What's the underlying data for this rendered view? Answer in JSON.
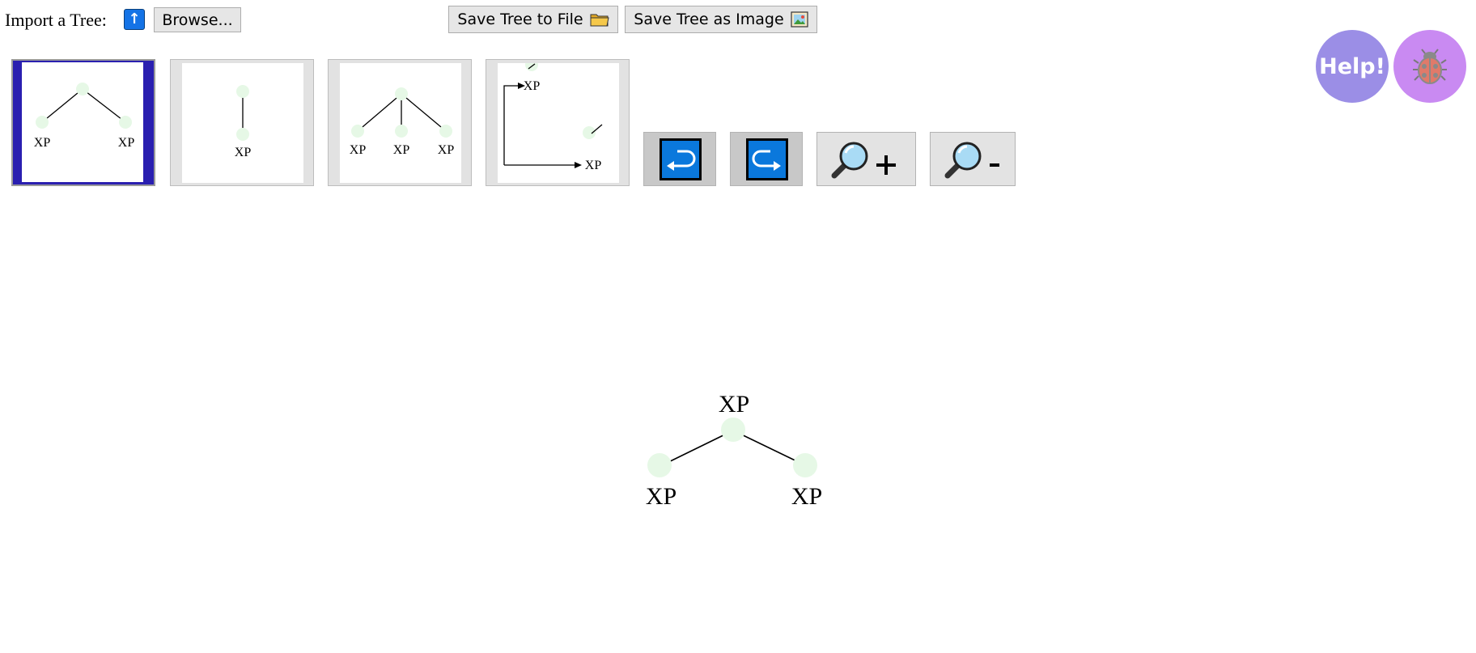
{
  "toolbar": {
    "import_label": "Import a Tree:",
    "upload_icon": "upload-arrow-icon",
    "browse_label": "Browse...",
    "save_file_label": "Save Tree to File",
    "save_image_label": "Save Tree as Image"
  },
  "templates": [
    {
      "id": "binary",
      "labels": [
        "XP",
        "XP"
      ],
      "selected": true
    },
    {
      "id": "unary",
      "labels": [
        "XP"
      ],
      "selected": false
    },
    {
      "id": "ternary",
      "labels": [
        "XP",
        "XP",
        "XP"
      ],
      "selected": false
    },
    {
      "id": "movement",
      "labels": [
        "XP",
        "XP"
      ],
      "selected": false
    }
  ],
  "tools": {
    "undo": "undo-icon",
    "redo": "redo-icon",
    "zoom_in": "zoom-in-icon",
    "zoom_out": "zoom-out-icon"
  },
  "help": {
    "label": "Help!",
    "color": "#9b8ee6"
  },
  "bug": {
    "icon": "bug-icon",
    "color": "#c98af2"
  },
  "canvas": {
    "root_label": "XP",
    "left_label": "XP",
    "right_label": "XP"
  },
  "colors": {
    "node": "#e6f8e6",
    "selected_frame": "#2a1fb0",
    "tool_blue": "#0a78dc"
  }
}
